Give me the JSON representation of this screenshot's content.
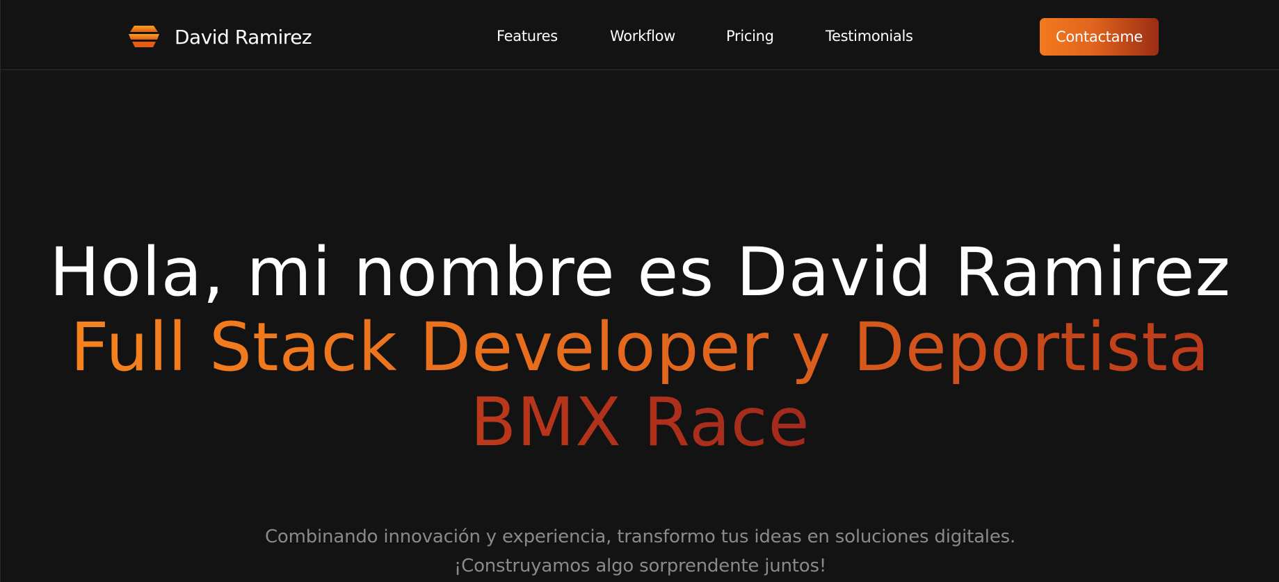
{
  "brand": {
    "name": "David Ramirez",
    "logo_icon": "stacked-layers-logo-icon",
    "colors": {
      "logo_top": "#f7a21b",
      "logo_bottom": "#e35d17"
    }
  },
  "nav": {
    "items": [
      {
        "label": "Features"
      },
      {
        "label": "Workflow"
      },
      {
        "label": "Pricing"
      },
      {
        "label": "Testimonials"
      }
    ],
    "cta_label": "Contactame"
  },
  "hero": {
    "title_plain": "Hola, mi nombre es David Ramirez",
    "title_accent": "Full Stack Developer y Deportista BMX Race",
    "subtitle_line1": "Combinando innovación y experiencia, transformo tus ideas en soluciones digitales.",
    "subtitle_line2": "¡Construyamos algo sorprendente juntos!"
  },
  "colors": {
    "background": "#131313",
    "accent_start": "#f6821f",
    "accent_end": "#a22a1c",
    "text": "#ffffff",
    "muted_text": "#8a8a8a"
  }
}
